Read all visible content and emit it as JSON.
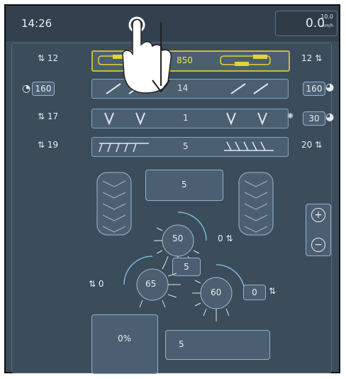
{
  "status": {
    "time": "14:26",
    "speed": "0.0",
    "speed_max": "10.0",
    "speed_unit": "km/h"
  },
  "rows": {
    "tines": {
      "left": "12",
      "value": "850",
      "right": "12"
    },
    "disc": {
      "left_box": "160",
      "value": "14",
      "right_box": "160"
    },
    "coulter": {
      "left": "17",
      "value": "1",
      "right_box": "30"
    },
    "harrow": {
      "left": "19",
      "value": "5",
      "right": "20"
    }
  },
  "center": {
    "top_box": "5",
    "rotor_top": "50",
    "rotor_top_label": "0",
    "mid_box": "5",
    "rotor_left": "65",
    "rotor_left_label": "0",
    "rotor_right": "60",
    "rotor_right_box": "0"
  },
  "bottom": {
    "tank_percent": "0%",
    "roller_value": "5"
  },
  "icons": [
    "plus-icon",
    "minus-icon",
    "arrows-updown-icon",
    "gauge-icon",
    "hand-pointer-icon"
  ]
}
